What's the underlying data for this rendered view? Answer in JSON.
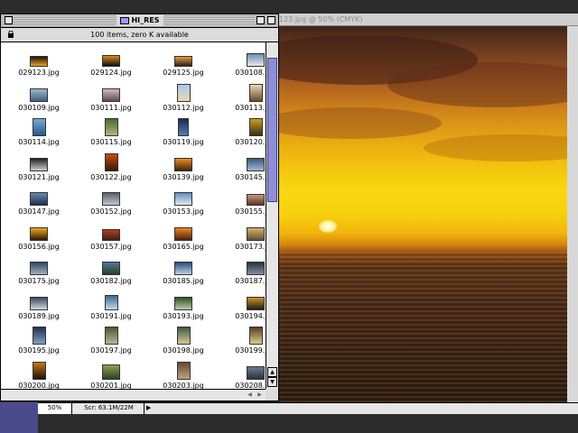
{
  "finder": {
    "title": "HI_RES",
    "info": "100 items, zero K available",
    "files": [
      {
        "name": "029123.jpg",
        "c1": "#1a1410",
        "c2": "#f0a020",
        "w": 20,
        "h": 12
      },
      {
        "name": "029124.jpg",
        "c1": "#d88a20",
        "c2": "#101010",
        "w": 20,
        "h": 13
      },
      {
        "name": "029125.jpg",
        "c1": "#e89a40",
        "c2": "#302018",
        "w": 20,
        "h": 12
      },
      {
        "name": "030108.jpg",
        "c1": "#6b8fb0",
        "c2": "#e8e8f0",
        "w": 20,
        "h": 15
      },
      {
        "name": "030109.jpg",
        "c1": "#9ab8d0",
        "c2": "#406080",
        "w": 20,
        "h": 15
      },
      {
        "name": "030111.jpg",
        "c1": "#d8b8c0",
        "c2": "#5a4a60",
        "w": 20,
        "h": 15
      },
      {
        "name": "030112.jpg",
        "c1": "#a8c8e8",
        "c2": "#e8d8b0",
        "w": 15,
        "h": 20
      },
      {
        "name": "030113.jpg",
        "c1": "#e8d8b8",
        "c2": "#6a4a20",
        "w": 15,
        "h": 20
      },
      {
        "name": "030114.jpg",
        "c1": "#78a8d8",
        "c2": "#2a5a8a",
        "w": 15,
        "h": 20
      },
      {
        "name": "030115.jpg",
        "c1": "#4a6a30",
        "c2": "#a8b880",
        "w": 15,
        "h": 20
      },
      {
        "name": "030119.jpg",
        "c1": "#1a2a50",
        "c2": "#5a7ab0",
        "w": 12,
        "h": 20
      },
      {
        "name": "030120.jpg",
        "c1": "#c8a020",
        "c2": "#3a3018",
        "w": 15,
        "h": 20
      },
      {
        "name": "030121.jpg",
        "c1": "#202020",
        "c2": "#d0d0d0",
        "w": 20,
        "h": 15
      },
      {
        "name": "030122.jpg",
        "c1": "#c84a10",
        "c2": "#3a1a08",
        "w": 15,
        "h": 20
      },
      {
        "name": "030139.jpg",
        "c1": "#e89020",
        "c2": "#402010",
        "w": 20,
        "h": 15
      },
      {
        "name": "030145.jpg",
        "c1": "#3a5a80",
        "c2": "#a0b8d0",
        "w": 20,
        "h": 15
      },
      {
        "name": "030147.jpg",
        "c1": "#6888b0",
        "c2": "#203050",
        "w": 20,
        "h": 15
      },
      {
        "name": "030152.jpg",
        "c1": "#5a6070",
        "c2": "#c0c8d0",
        "w": 20,
        "h": 15
      },
      {
        "name": "030153.jpg",
        "c1": "#6090c0",
        "c2": "#e0e8f0",
        "w": 20,
        "h": 15
      },
      {
        "name": "030155.jpg",
        "c1": "#c89878",
        "c2": "#5a3828",
        "w": 20,
        "h": 13
      },
      {
        "name": "030156.jpg",
        "c1": "#f0a818",
        "c2": "#2a1808",
        "w": 20,
        "h": 15
      },
      {
        "name": "030157.jpg",
        "c1": "#b04020",
        "c2": "#402018",
        "w": 20,
        "h": 13
      },
      {
        "name": "030165.jpg",
        "c1": "#e88820",
        "c2": "#4a2010",
        "w": 20,
        "h": 15
      },
      {
        "name": "030173.jpg",
        "c1": "#d8b060",
        "c2": "#605040",
        "w": 20,
        "h": 15
      },
      {
        "name": "030175.jpg",
        "c1": "#304860",
        "c2": "#a0b0c0",
        "w": 20,
        "h": 15
      },
      {
        "name": "030182.jpg",
        "c1": "#5078a0",
        "c2": "#2a4020",
        "w": 20,
        "h": 15
      },
      {
        "name": "030185.jpg",
        "c1": "#2a4a80",
        "c2": "#c0d0e0",
        "w": 20,
        "h": 15
      },
      {
        "name": "030187.jpg",
        "c1": "#2a3040",
        "c2": "#8090a0",
        "w": 20,
        "h": 15
      },
      {
        "name": "030189.jpg",
        "c1": "#3a4a5a",
        "c2": "#d0d8e0",
        "w": 20,
        "h": 15
      },
      {
        "name": "030191.jpg",
        "c1": "#3a6a90",
        "c2": "#c8d8e8",
        "w": 15,
        "h": 17
      },
      {
        "name": "030193.jpg",
        "c1": "#305020",
        "c2": "#c0c8b0",
        "w": 20,
        "h": 15
      },
      {
        "name": "030194.jpg",
        "c1": "#c89030",
        "c2": "#202010",
        "w": 20,
        "h": 15
      },
      {
        "name": "030195.jpg",
        "c1": "#203050",
        "c2": "#80a0c0",
        "w": 15,
        "h": 20
      },
      {
        "name": "030197.jpg",
        "c1": "#4a5a30",
        "c2": "#b0b890",
        "w": 15,
        "h": 20
      },
      {
        "name": "030198.jpg",
        "c1": "#3a5a4a",
        "c2": "#d8c890",
        "w": 15,
        "h": 20
      },
      {
        "name": "030199.jpg",
        "c1": "#5a4020",
        "c2": "#e0c890",
        "w": 15,
        "h": 20
      },
      {
        "name": "030200.jpg",
        "c1": "#c87818",
        "c2": "#201008",
        "w": 15,
        "h": 20
      },
      {
        "name": "030201.jpg",
        "c1": "#8aa050",
        "c2": "#304020",
        "w": 20,
        "h": 17
      },
      {
        "name": "030203.jpg",
        "c1": "#6a4a30",
        "c2": "#c0a080",
        "w": 15,
        "h": 20
      },
      {
        "name": "030208.jpg",
        "c1": "#6a7a90",
        "c2": "#2a3040",
        "w": 20,
        "h": 15
      }
    ]
  },
  "photo_window": {
    "title": "123.jpg @ 50% (CMYK)"
  },
  "statusbar": {
    "zoom": "50%",
    "scratch": "Scr: 63.1M/22M"
  }
}
